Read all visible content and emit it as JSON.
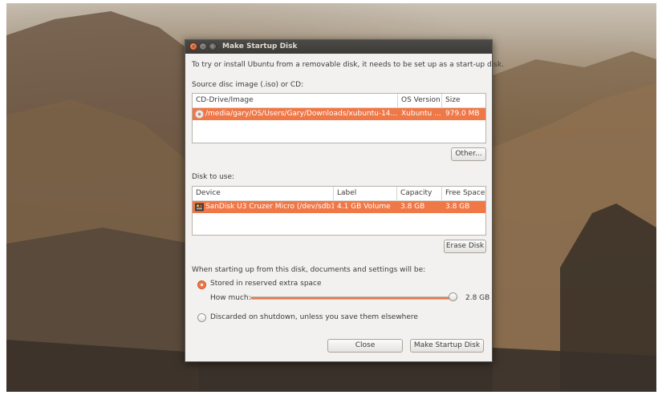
{
  "window": {
    "title": "Make Startup Disk",
    "close_glyph": "×",
    "min_glyph": "–",
    "max_glyph": "□"
  },
  "intro_text": "To try or install Ubuntu from a removable disk, it needs to be set up as a start-up disk.",
  "source": {
    "label": "Source disc image (.iso) or CD:",
    "columns": [
      "CD-Drive/Image",
      "OS Version",
      "Size"
    ],
    "rows": [
      {
        "icon": "disc-icon",
        "image": "/media/gary/OS/Users/Gary/Downloads/xubuntu-14....",
        "os_version": "Xubuntu ...",
        "size": "979.0 MB"
      }
    ],
    "other_button": "Other..."
  },
  "disk": {
    "label": "Disk to use:",
    "columns": [
      "Device",
      "Label",
      "Capacity",
      "Free Space"
    ],
    "rows": [
      {
        "icon": "usb-drive-icon",
        "device": "SanDisk U3 Cruzer Micro (/dev/sdb1)",
        "label": "4.1 GB Volume",
        "capacity": "3.8 GB",
        "free_space": "3.8 GB"
      }
    ],
    "erase_button": "Erase Disk"
  },
  "persistence": {
    "label": "When starting up from this disk, documents and settings will be:",
    "option_stored": "Stored in reserved extra space",
    "option_discard": "Discarded on shutdown, unless you save them elsewhere",
    "selected": "stored",
    "how_much_label": "How much:",
    "slider_fraction": 0.98,
    "slider_value": "2.8 GB"
  },
  "buttons": {
    "close": "Close",
    "make": "Make Startup Disk"
  },
  "colors": {
    "accent": "#f07746",
    "titlebar": "#3c3b37"
  }
}
